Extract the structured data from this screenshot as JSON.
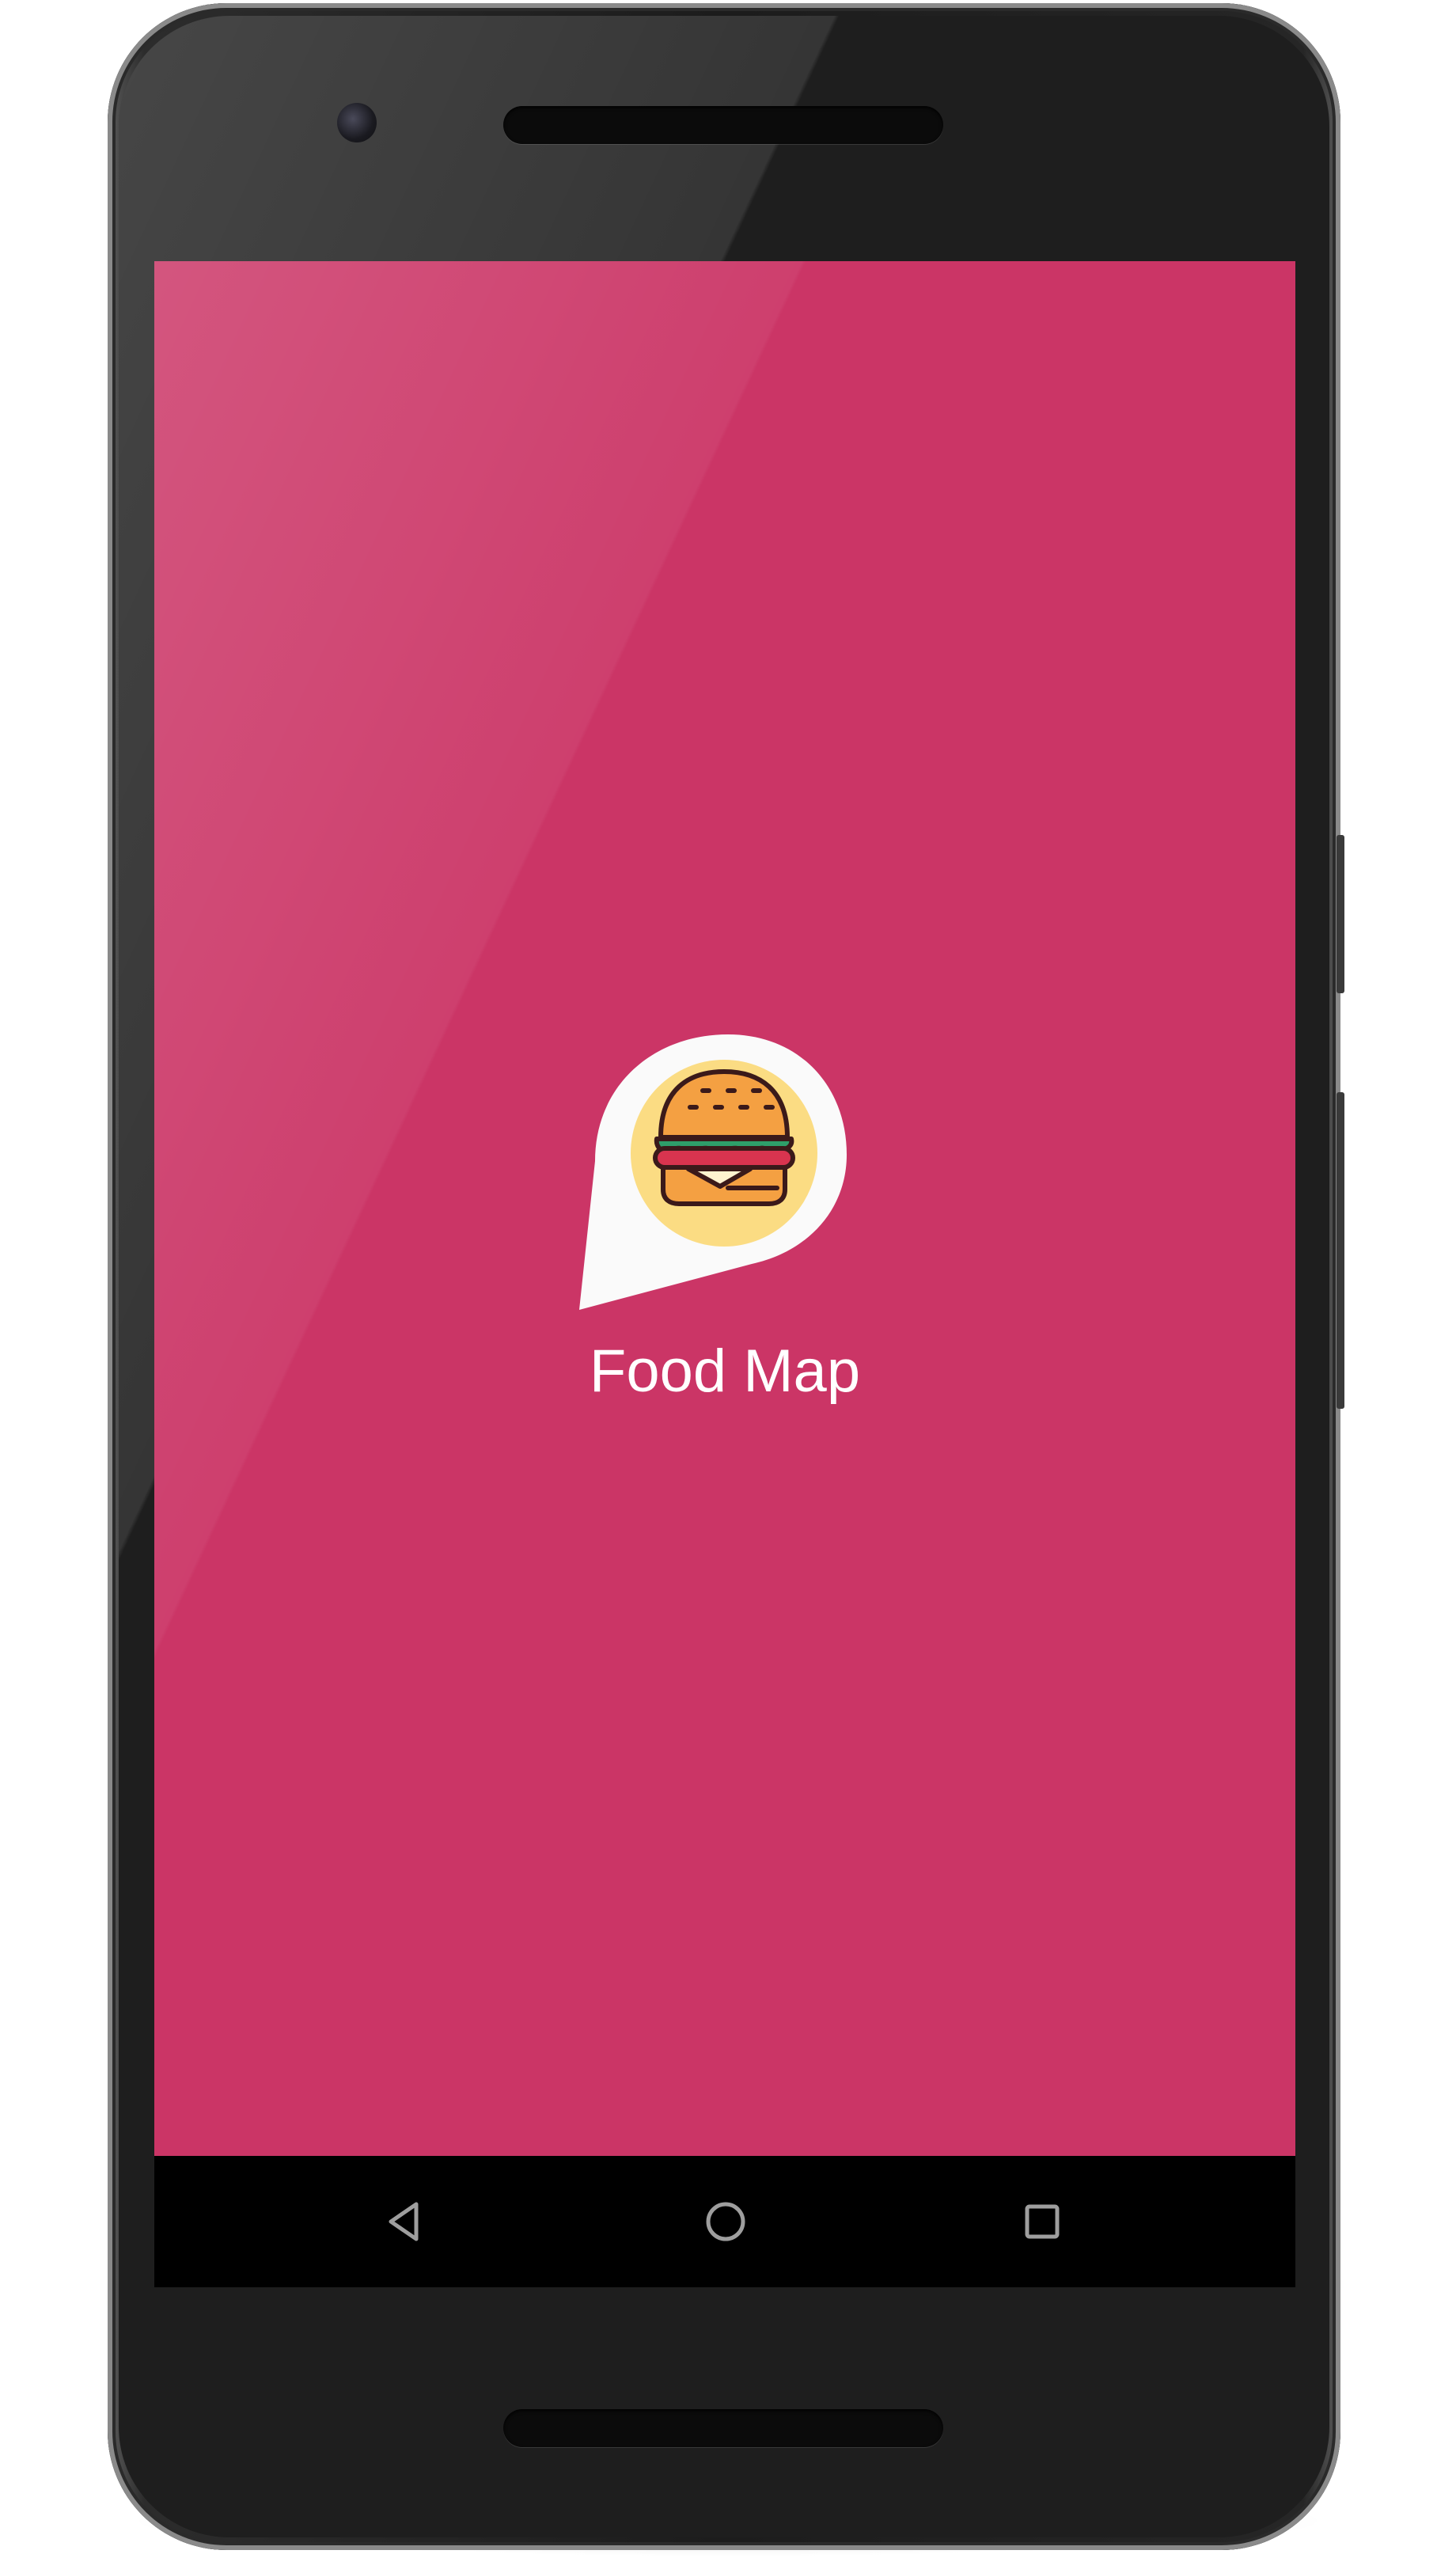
{
  "app": {
    "name": "Food Map"
  },
  "colors": {
    "screen_background": "#cb3566",
    "logo_pin": "#fafafa",
    "logo_circle": "#fbdc83",
    "bun": "#f4a042",
    "lettuce": "#2e9e6a",
    "tomato": "#d8344f",
    "outline": "#3b1a1a",
    "nav_bar": "#000000",
    "nav_icon": "#9e9e9e"
  },
  "icons": {
    "logo": "burger-map-pin-icon",
    "back": "triangle-back-icon",
    "home": "circle-home-icon",
    "recents": "square-recents-icon"
  }
}
